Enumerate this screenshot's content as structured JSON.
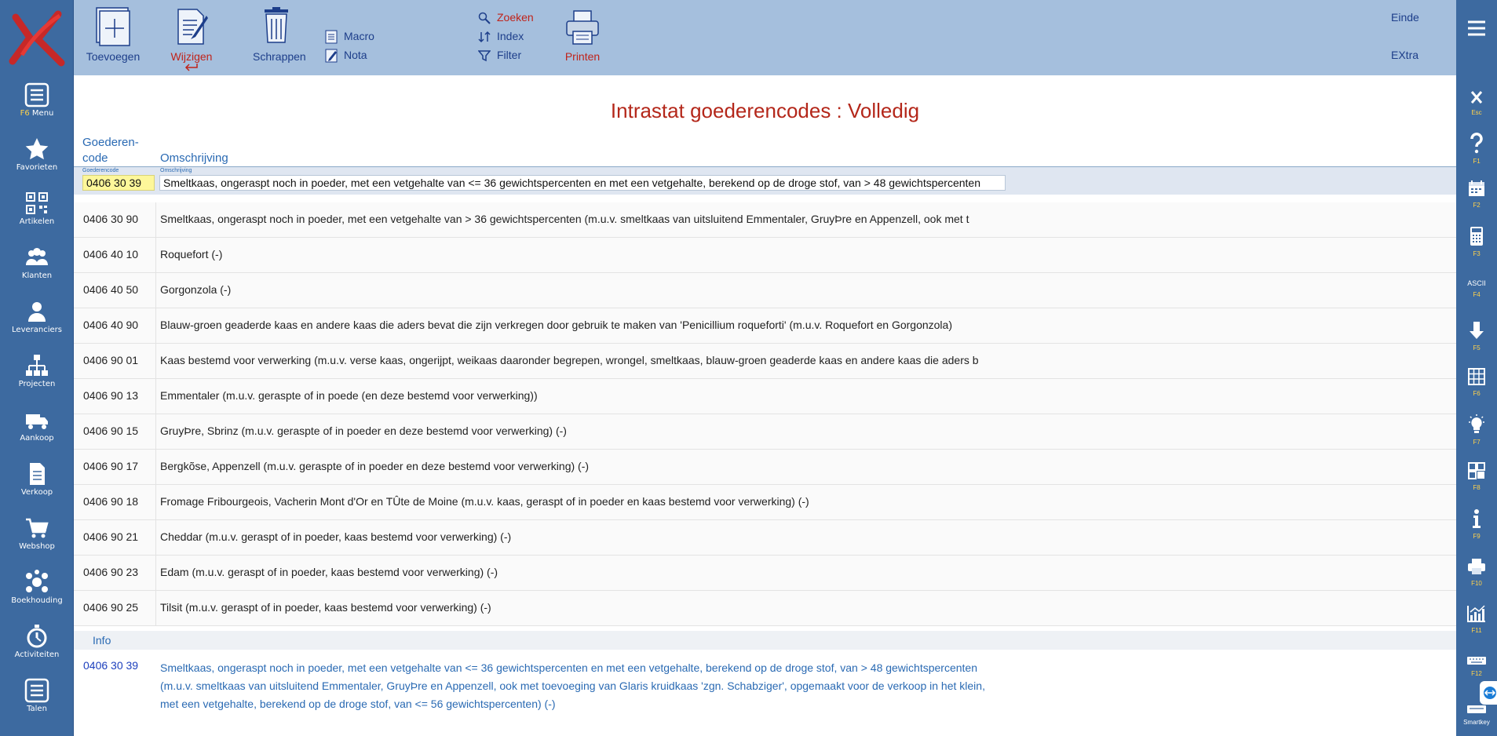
{
  "sidebar": {
    "items": [
      {
        "key": "F6",
        "label": "Menu",
        "icon": "menu-icon"
      },
      {
        "label": "Favorieten",
        "icon": "star-icon"
      },
      {
        "label": "Artikelen",
        "icon": "qr-code-icon"
      },
      {
        "label": "Klanten",
        "icon": "users-icon"
      },
      {
        "label": "Leveranciers",
        "icon": "user-icon"
      },
      {
        "label": "Projecten",
        "icon": "hierarchy-icon"
      },
      {
        "label": "Aankoop",
        "icon": "truck-icon"
      },
      {
        "label": "Verkoop",
        "icon": "document-icon"
      },
      {
        "label": "Webshop",
        "icon": "cart-icon"
      },
      {
        "label": "Boekhouding",
        "icon": "network-icon"
      },
      {
        "label": "Activiteiten",
        "icon": "stopwatch-icon"
      },
      {
        "label": "Talen",
        "icon": "list-icon"
      }
    ]
  },
  "toolbar": {
    "add": "Toevoegen",
    "edit": "Wijzigen",
    "delete": "Schrappen",
    "macro": "Macro",
    "nota": "Nota",
    "search": "Zoeken",
    "index": "Index",
    "filter": "Filter",
    "print": "Printen",
    "quit": "Einde",
    "extra": "EXtra"
  },
  "rightbar": {
    "keys": [
      {
        "key": "Esc",
        "icon": "close-icon"
      },
      {
        "key": "F1",
        "icon": "help-icon"
      },
      {
        "key": "F2",
        "icon": "calendar-icon"
      },
      {
        "key": "F3",
        "icon": "calculator-icon"
      },
      {
        "key": "F4",
        "label": "ASCII",
        "icon": "ascii-icon"
      },
      {
        "key": "F5",
        "icon": "arrow-down-icon"
      },
      {
        "key": "F6",
        "icon": "grid-icon"
      },
      {
        "key": "F7",
        "icon": "lightbulb-icon"
      },
      {
        "key": "F8",
        "icon": "layout-icon"
      },
      {
        "key": "F9",
        "icon": "info-icon"
      },
      {
        "key": "F10",
        "icon": "printer-icon"
      },
      {
        "key": "F11",
        "icon": "chart-icon"
      },
      {
        "key": "F12",
        "icon": "keyboard-icon"
      },
      {
        "key": "Smartkey",
        "icon": "smartkey-icon"
      }
    ]
  },
  "page": {
    "title": "Intrastat goederencodes : Volledig",
    "col_code_line1": "Goederen-",
    "col_code_line2": "code",
    "col_desc": "Omschrijving",
    "mini_code": "Goederencode",
    "mini_desc": "Omschrijving"
  },
  "selected": {
    "code": "0406 30 39",
    "desc": "Smeltkaas, ongeraspt noch in poeder, met een vetgehalte van <= 36 gewichtspercenten en met een vetgehalte, berekend op de droge stof, van > 48 gewichtspercenten"
  },
  "rows": [
    {
      "code": "0406 30 90",
      "desc": "Smeltkaas, ongeraspt noch in poeder, met een vetgehalte van > 36 gewichtspercenten (m.u.v. smeltkaas van uitsluitend Emmentaler, GruyÞre en Appenzell, ook met t"
    },
    {
      "code": "0406 40 10",
      "desc": "Roquefort (-)"
    },
    {
      "code": "0406 40 50",
      "desc": "Gorgonzola (-)"
    },
    {
      "code": "0406 40 90",
      "desc": "Blauw-groen geaderde kaas en andere kaas die aders bevat die zijn verkregen door gebruik te maken van 'Penicillium roqueforti' (m.u.v. Roquefort en Gorgonzola)"
    },
    {
      "code": "0406 90 01",
      "desc": "Kaas bestemd voor verwerking (m.u.v. verse kaas, ongerijpt, weikaas daaronder begrepen, wrongel, smeltkaas, blauw-groen geaderde kaas en andere kaas die aders b"
    },
    {
      "code": "0406 90 13",
      "desc": "Emmentaler (m.u.v. geraspte of in poede (en deze bestemd voor verwerking))"
    },
    {
      "code": "0406 90 15",
      "desc": "GruyÞre, Sbrinz (m.u.v. geraspte of in poeder en deze bestemd voor verwerking) (-)"
    },
    {
      "code": "0406 90 17",
      "desc": "Bergkõse, Appenzell (m.u.v. geraspte of in poeder en deze bestemd voor verwerking) (-)"
    },
    {
      "code": "0406 90 18",
      "desc": "Fromage Fribourgeois, Vacherin Mont d'Or en TÛte de Moine (m.u.v. kaas, geraspt of in poeder en kaas bestemd voor verwerking) (-)"
    },
    {
      "code": "0406 90 21",
      "desc": "Cheddar (m.u.v. geraspt of in poeder, kaas bestemd voor verwerking) (-)"
    },
    {
      "code": "0406 90 23",
      "desc": "Edam (m.u.v. geraspt of in poeder, kaas bestemd voor verwerking) (-)"
    },
    {
      "code": "0406 90 25",
      "desc": "Tilsit (m.u.v. geraspt of in poeder, kaas bestemd voor verwerking) (-)"
    }
  ],
  "info": {
    "label": "Info",
    "code": "0406 30 39",
    "desc": "Smeltkaas, ongeraspt noch in poeder, met een vetgehalte van <= 36 gewichtspercenten en met een vetgehalte, berekend op de droge stof, van > 48 gewichtspercenten (m.u.v. smeltkaas van uitsluitend Emmentaler, GruyÞre en Appenzell, ook met toevoeging van Glaris kruidkaas 'zgn. Schabziger', opgemaakt voor de verkoop in het klein, met een vetgehalte, berekend op de droge stof, van <= 56 gewichtspercenten) (-)"
  }
}
